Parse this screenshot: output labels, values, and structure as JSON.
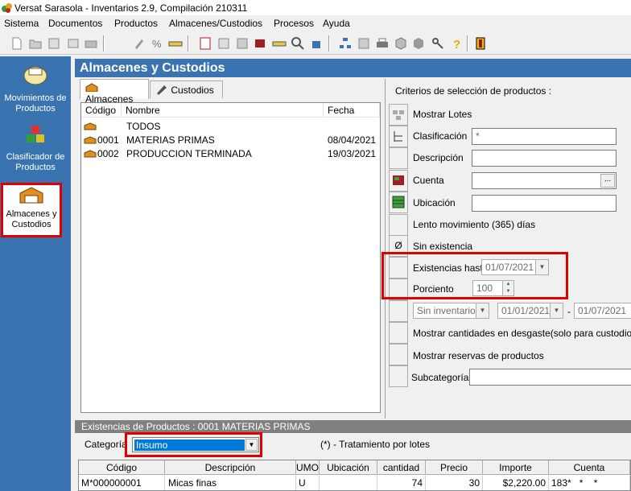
{
  "window": {
    "title": "Versat Sarasola - Inventarios  2.9,  Compilación 210311"
  },
  "menu": {
    "items": [
      "Sistema",
      "Documentos",
      "Productos",
      "Almacenes/Custodios",
      "Procesos",
      "Ayuda"
    ]
  },
  "sidebar": {
    "items": [
      {
        "label": "Movimientos de Productos",
        "icon": "package-icon"
      },
      {
        "label": "Clasificador de Productos",
        "icon": "cubes-icon"
      },
      {
        "label": "Almacenes y Custodios",
        "icon": "warehouse-icon",
        "selected": true
      }
    ]
  },
  "panel": {
    "title": "Almacenes y Custodios"
  },
  "tabs": [
    {
      "label": "Almacenes"
    },
    {
      "label": "Custodios"
    }
  ],
  "list": {
    "columns": [
      "Código",
      "Nombre",
      "Fecha"
    ],
    "rows": [
      {
        "code": "",
        "name": "TODOS",
        "date": ""
      },
      {
        "code": "0001",
        "name": "MATERIAS PRIMAS",
        "date": "08/04/2021"
      },
      {
        "code": "0002",
        "name": "PRODUCCION TERMINADA",
        "date": "19/03/2021"
      }
    ]
  },
  "criteria": {
    "heading": "Criterios de selección de productos :",
    "mostrar_lotes": "Mostrar Lotes",
    "clasificacion": "Clasificación",
    "clasificacion_value": "*",
    "descripcion": "Descripción",
    "cuenta": "Cuenta",
    "cuenta_btn": "...",
    "ubicacion": "Ubicación",
    "lento": "Lento movimiento (365) días",
    "zero_icon": "Ø",
    "sin_existencia": "Sin existencia",
    "existencias_hasta": "Existencias hasta",
    "existencias_date": "01/07/2021",
    "porciento": "Porciento",
    "porciento_value": "100",
    "sin_inventario": "Sin inventario",
    "date_from": "01/01/2021",
    "date_sep": "-",
    "date_to": "01/07/2021",
    "desgaste": "Mostrar cantidades en desgaste(solo para custodios)",
    "reservas": "Mostrar reservas de productos",
    "subcategoria": "Subcategoría:"
  },
  "existencias": {
    "header": "Existencias de Productos : 0001 MATERIAS PRIMAS",
    "categoria_label": "Categoría",
    "categoria_value": "Insumo",
    "lotes_note": "(*) - Tratamiento por lotes",
    "columns": [
      "Código",
      "Descripción",
      "UMO",
      "Ubicación",
      "cantidad",
      "Precio",
      "Importe",
      "Cuenta"
    ],
    "rows": [
      {
        "codigo": "M*000000001",
        "descripcion": "Micas finas",
        "umo": "U",
        "ubicacion": "",
        "cantidad": "74",
        "precio": "30",
        "importe": "$2,220.00",
        "cuenta": "183*   *    *"
      }
    ]
  },
  "colors": {
    "accent": "#3a74b0",
    "highlight": "#e00000",
    "selection": "#0078d7"
  }
}
